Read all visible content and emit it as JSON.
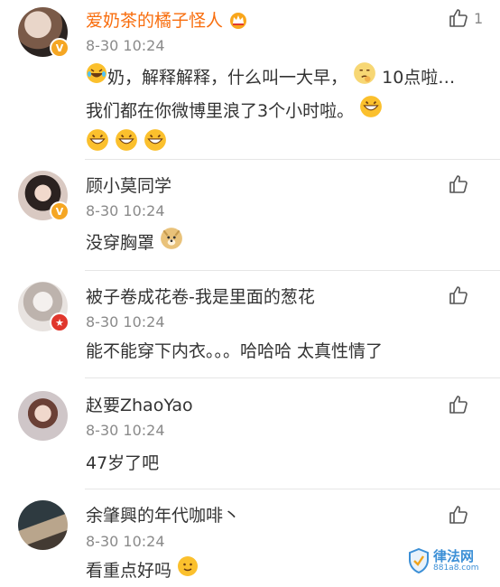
{
  "comments": [
    {
      "name": "爱奶茶的橘子怪人",
      "time": "8-30 10:24",
      "likes": "1",
      "text_parts": [
        "奶，解释解释，什么叫一大早，",
        "10点啦… 我们都在你微博里浪了3个小时啦。"
      ]
    },
    {
      "name": "顾小莫同学",
      "time": "8-30 10:24",
      "text": "没穿胸罩"
    },
    {
      "name": "被子卷成花卷-我是里面的葱花",
      "time": "8-30 10:24",
      "text": "能不能穿下内衣。。。哈哈哈 太真性情了"
    },
    {
      "name": "赵要ZhaoYao",
      "time": "8-30 10:24",
      "text": "47岁了吧"
    },
    {
      "name": "余肇興的年代咖啡丶",
      "time": "8-30 10:24",
      "text": "看重点好吗"
    }
  ],
  "watermark": {
    "title": "律法网",
    "sub": "881a8.com"
  },
  "colors": {
    "vip_name": "#f86d0d",
    "timestamp": "#8a8a8a",
    "divider": "#e6e6e6"
  }
}
